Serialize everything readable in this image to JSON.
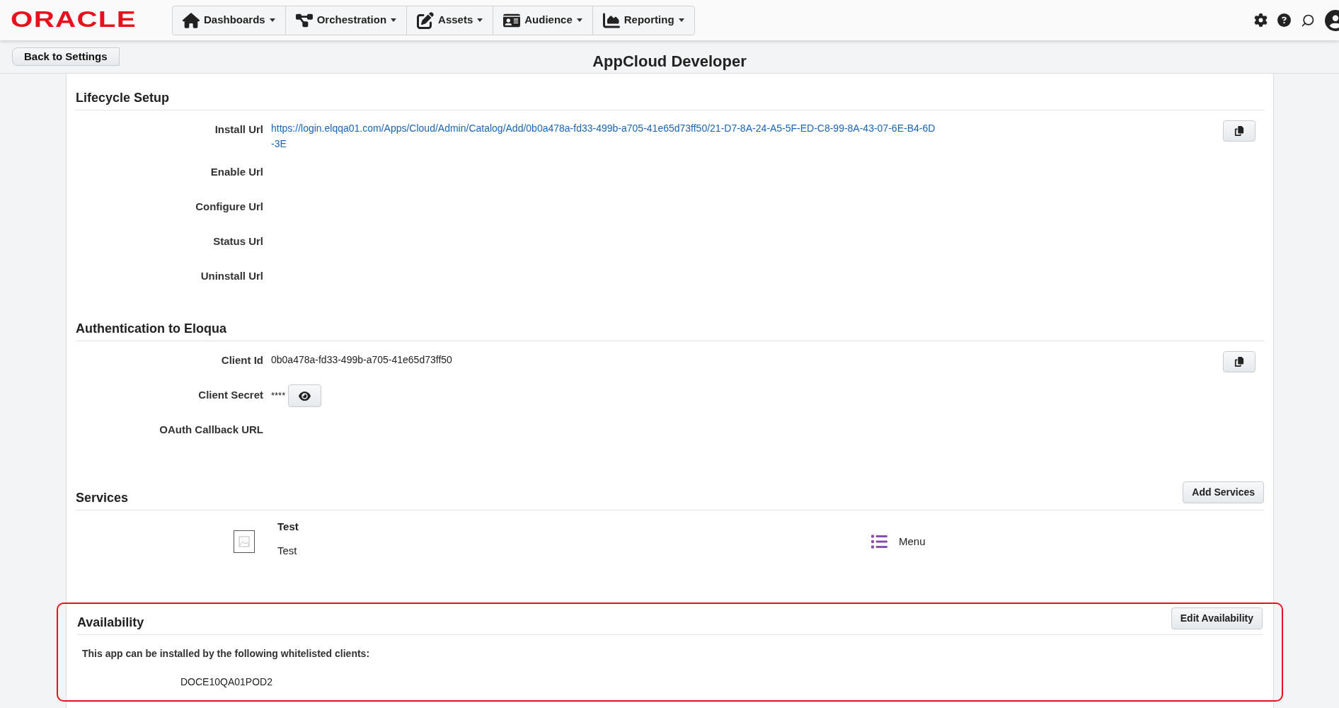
{
  "header": {
    "logo": "ORACLE",
    "nav": [
      {
        "label": "Dashboards"
      },
      {
        "label": "Orchestration"
      },
      {
        "label": "Assets"
      },
      {
        "label": "Audience"
      },
      {
        "label": "Reporting"
      }
    ]
  },
  "back_button": "Back to Settings",
  "page_title": "AppCloud Developer",
  "sections": [
    {
      "kind": "fields",
      "title": "Lifecycle Setup",
      "fields": [
        {
          "label": "Install Url",
          "kind": "link",
          "value": "https://login.elqqa01.com/Apps/Cloud/Admin/Catalog/Add/0b0a478a-fd33-499b-a705-41e65d73ff50/21-D7-8A-24-A5-5F-ED-C8-99-8A-43-07-6E-B4-6D-3E",
          "copy_button": true
        },
        {
          "label": "Enable Url",
          "copy_button": false
        },
        {
          "label": "Configure Url",
          "copy_button": false
        },
        {
          "label": "Status Url",
          "copy_button": false
        },
        {
          "label": "Uninstall Url",
          "copy_button": false
        }
      ]
    },
    {
      "kind": "fields",
      "title": "Authentication to Eloqua",
      "fields": [
        {
          "label": "Client Id",
          "kind": "text",
          "value": "0b0a478a-fd33-499b-a705-41e65d73ff50",
          "copy_button": true
        },
        {
          "label": "Client Secret",
          "kind": "secret",
          "value": "****",
          "copy_button": false
        },
        {
          "label": "OAuth Callback URL",
          "copy_button": false
        }
      ]
    },
    {
      "kind": "services",
      "title": "Services",
      "button": "Add Services",
      "services": [
        {
          "name": "Test",
          "description": "Test",
          "type": "Menu"
        }
      ]
    },
    {
      "kind": "availability",
      "title": "Availability",
      "button": "Edit Availability",
      "highlighted": true,
      "text": "This app can be installed by the following whitelisted clients:",
      "clients": [
        "DOCE10QA01POD2"
      ]
    }
  ]
}
